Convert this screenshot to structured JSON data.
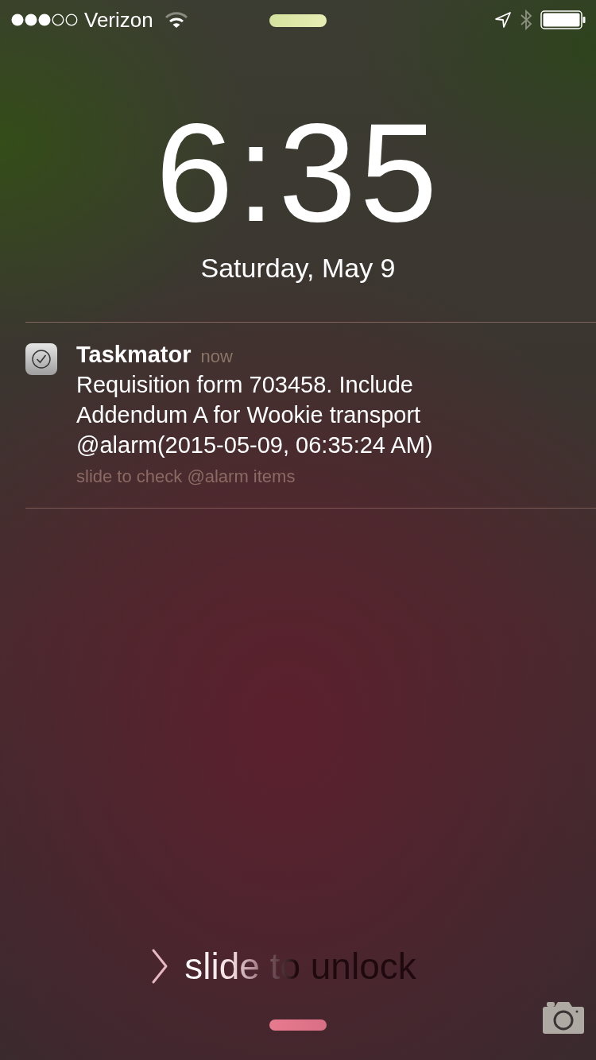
{
  "status_bar": {
    "carrier": "Verizon"
  },
  "clock": {
    "time": "6:35",
    "date": "Saturday, May 9"
  },
  "notifications": [
    {
      "app": "Taskmator",
      "time": "now",
      "message": "Requisition form 703458. Include Addendum A for Wookie transport @alarm(2015-05-09, 06:35:24 AM)",
      "action_hint": "slide to check @alarm items"
    }
  ],
  "unlock": {
    "label": "slide to unlock"
  }
}
